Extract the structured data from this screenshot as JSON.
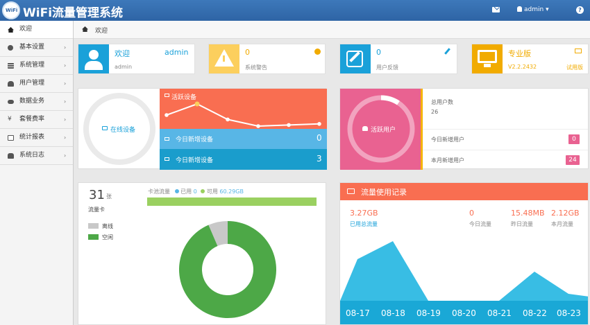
{
  "app": {
    "title": "WiFi流量管理系统",
    "logo_text": "WiFi",
    "user": "admin",
    "user_caret": "▾",
    "help": "?"
  },
  "sidebar": {
    "items": [
      {
        "label": "欢迎",
        "icon": "home-icon",
        "active": true,
        "chevron": ""
      },
      {
        "label": "基本设置",
        "icon": "gear-icon",
        "chevron": "›"
      },
      {
        "label": "系统管理",
        "icon": "list-icon",
        "chevron": "›"
      },
      {
        "label": "用户管理",
        "icon": "users-icon",
        "chevron": "›"
      },
      {
        "label": "数据业务",
        "icon": "cloud-icon",
        "chevron": "›"
      },
      {
        "label": "套餐费率",
        "icon": "yen-icon",
        "chevron": "›"
      },
      {
        "label": "统计报表",
        "icon": "chart-icon",
        "chevron": "›"
      },
      {
        "label": "系统日志",
        "icon": "hdd-icon",
        "chevron": "›"
      }
    ]
  },
  "breadcrumb": {
    "label": "欢迎"
  },
  "cards": {
    "welcome": {
      "title": "欢迎",
      "name": "admin",
      "sub": "admin",
      "color": "#1aa1d9"
    },
    "alarm": {
      "value": "0",
      "label": "系统警告",
      "color": "#fccf5d"
    },
    "feedback": {
      "value": "0",
      "label": "用户反馈",
      "color": "#1aa1d9"
    },
    "edition": {
      "title": "专业版",
      "version": "V2.2.2432",
      "trial": "试用版",
      "color": "#f1ab00"
    }
  },
  "devices": {
    "online_label": "在线设备",
    "active_label": "活跃设备",
    "new_today_label": "今日新增设备",
    "new_today": "0",
    "new_month_label": "今日新增设备",
    "new_month": "3",
    "trend": [
      2,
      3,
      1.6,
      1,
      1.1,
      1.2
    ]
  },
  "users": {
    "active_label": "活跃用户",
    "total_label": "总用户数",
    "total": "26",
    "today_label": "今日新增用户",
    "today": "0",
    "month_label": "本月新增用户",
    "month": "24"
  },
  "cards_stats": {
    "count": "31",
    "unit": "张",
    "label": "流量卡",
    "legend": [
      {
        "label": "离线",
        "color": "#c8c8c8"
      },
      {
        "label": "空闲",
        "color": "#4da847"
      }
    ],
    "pool_label": "卡池流量",
    "used_label": "已用",
    "used": "0",
    "avail_label": "可用",
    "avail": "60.29GB",
    "pie": {
      "offline": 2,
      "idle": 29
    }
  },
  "traffic": {
    "title": "流量使用记录",
    "stats": [
      {
        "value": "3.27GB",
        "label": "已用总流量"
      },
      {
        "value": "0",
        "label": "今日流量"
      },
      {
        "value": "15.48MB",
        "label": "昨日流量"
      },
      {
        "value": "2.12GB",
        "label": "本月流量"
      }
    ],
    "dates": [
      "08-17",
      "08-18",
      "08-19",
      "08-20",
      "08-21",
      "08-22",
      "08-23"
    ],
    "area": [
      60,
      86,
      0,
      0,
      0,
      42,
      10
    ]
  }
}
